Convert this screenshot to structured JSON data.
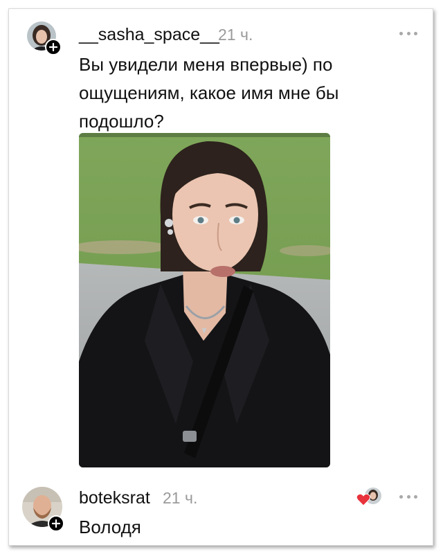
{
  "post": {
    "username": "__sasha_space__",
    "time": "21 ч.",
    "text_line1": "Вы увидели меня впервые) по",
    "text_line2": "ощущениям, какое имя мне бы",
    "text_line3": "подошло?",
    "avatar_icon": "user-avatar-icon",
    "follow_icon": "plus-icon",
    "more_icon": "more-dots-icon",
    "photo_icon": "selfie-photo"
  },
  "reply": {
    "username": "boteksrat",
    "time": "21 ч.",
    "text": "Володя",
    "avatar_icon": "user-avatar-icon",
    "liked_by_author_icon": "heart-icon",
    "heart_color": "#e8323c",
    "more_icon": "more-dots-icon"
  }
}
